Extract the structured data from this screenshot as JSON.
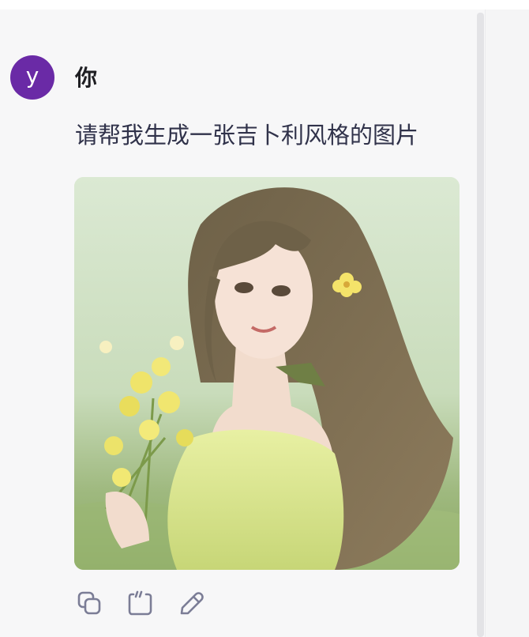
{
  "message": {
    "avatar_letter": "y",
    "sender": "你",
    "text": "请帮我生成一张吉卜利风格的图片"
  },
  "image": {
    "subject": "anime-style girl holding yellow flowers"
  },
  "actions": [
    {
      "name": "copy",
      "icon": "copy-icon"
    },
    {
      "name": "quote",
      "icon": "quote-icon"
    },
    {
      "name": "edit",
      "icon": "pencil-icon"
    }
  ],
  "colors": {
    "avatar": "#6a2aa6",
    "icon": "#7b7d96",
    "text": "#30324a"
  }
}
